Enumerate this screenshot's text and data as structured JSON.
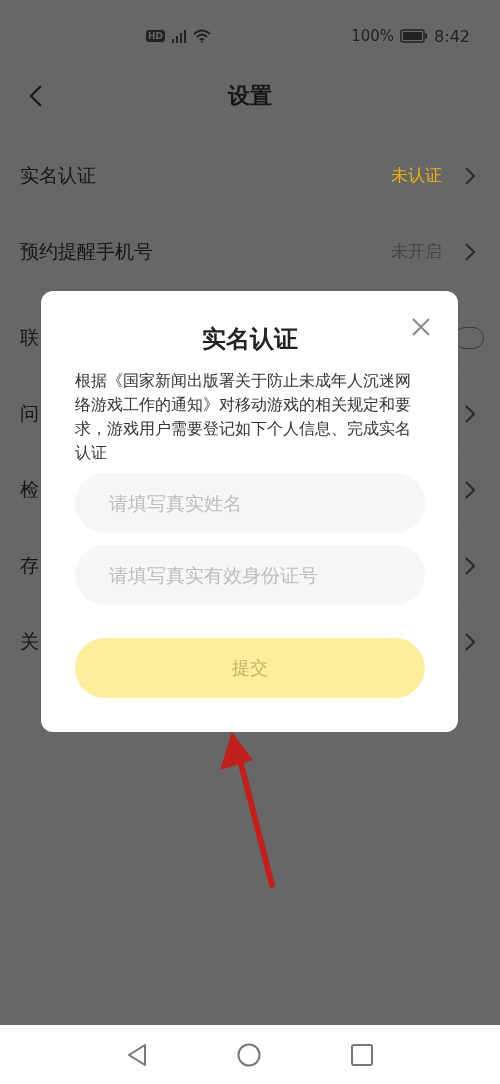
{
  "status_bar": {
    "hd": "HD",
    "battery": "100%",
    "time": "8:42"
  },
  "header": {
    "title": "设置"
  },
  "rows": [
    {
      "label": "实名认证",
      "value": "未认证",
      "alert": true,
      "kind": "value"
    },
    {
      "label": "预约提醒手机号",
      "value": "未开启",
      "alert": false,
      "kind": "value"
    },
    {
      "label": "联",
      "kind": "badge"
    },
    {
      "label": "问",
      "kind": "chevron"
    },
    {
      "label": "检",
      "kind": "chevron"
    },
    {
      "label": "存",
      "kind": "chevron"
    },
    {
      "label": "关",
      "kind": "chevron"
    }
  ],
  "dialog": {
    "title": "实名认证",
    "description": "根据《国家新闻出版署关于防止未成年人沉迷网络游戏工作的通知》对移动游戏的相关规定和要求，游戏用户需要登记如下个人信息、完成实名认证",
    "fields": [
      {
        "placeholder": "请填写真实姓名"
      },
      {
        "placeholder": "请填写真实有效身份证号"
      }
    ],
    "submit": {
      "label": "提交",
      "disabled": true
    }
  }
}
